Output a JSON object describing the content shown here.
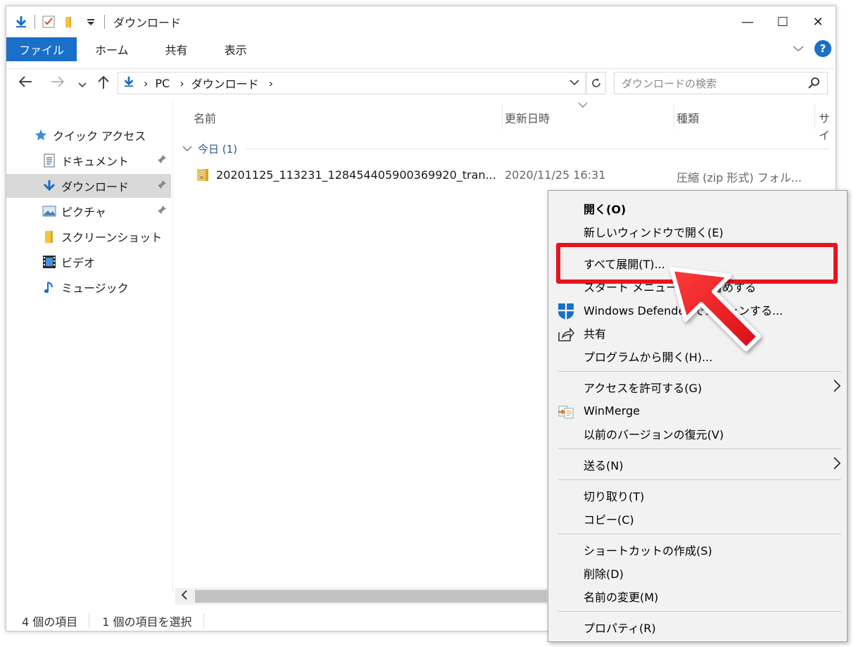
{
  "window": {
    "title": "ダウンロード",
    "controls": {
      "minimize": "—",
      "maximize": "☐",
      "close": "✕"
    }
  },
  "ribbon": {
    "tabs": [
      {
        "label": "ファイル"
      },
      {
        "label": "ホーム"
      },
      {
        "label": "共有"
      },
      {
        "label": "表示"
      }
    ],
    "help": "?"
  },
  "address": {
    "segments": [
      "PC",
      "ダウンロード"
    ],
    "search_placeholder": "ダウンロードの検索"
  },
  "nav": {
    "quick_access": "クイック アクセス",
    "items": [
      {
        "label": "ドキュメント",
        "icon": "document-icon",
        "pinned": true
      },
      {
        "label": "ダウンロード",
        "icon": "download-icon",
        "pinned": true,
        "selected": true
      },
      {
        "label": "ピクチャ",
        "icon": "picture-icon",
        "pinned": true
      },
      {
        "label": "スクリーンショット",
        "icon": "folder-icon",
        "pinned": false
      },
      {
        "label": "ビデオ",
        "icon": "video-icon",
        "pinned": false
      },
      {
        "label": "ミュージック",
        "icon": "music-icon",
        "pinned": false
      }
    ]
  },
  "list": {
    "columns": [
      "名前",
      "更新日時",
      "種類",
      "サイ"
    ],
    "group": "今日 (1)",
    "rows": [
      {
        "name": "20201125_113231_128454405900369920_tran...",
        "date": "2020/11/25 16:31",
        "type": "圧縮 (zip 形式) フォル..."
      }
    ]
  },
  "status": {
    "count": "4 個の項目",
    "selected": "1 個の項目を選択"
  },
  "context_menu": {
    "items": [
      {
        "label": "開く(O)",
        "bold": true
      },
      {
        "label": "新しいウィンドウで開く(E)"
      },
      {
        "label": "すべて展開(T)..."
      },
      {
        "label": "スタート メニューにピン留めする"
      },
      {
        "label": "Windows Defender でスキャンする..."
      },
      {
        "label": "共有"
      },
      {
        "label": "プログラムから開く(H)..."
      },
      {
        "label": "アクセスを許可する(G)"
      },
      {
        "label": "WinMerge"
      },
      {
        "label": "以前のバージョンの復元(V)"
      },
      {
        "label": "送る(N)"
      },
      {
        "label": "切り取り(T)"
      },
      {
        "label": "コピー(C)"
      },
      {
        "label": "ショートカットの作成(S)"
      },
      {
        "label": "削除(D)"
      },
      {
        "label": "名前の変更(M)"
      },
      {
        "label": "プロパティ(R)"
      }
    ]
  },
  "colors": {
    "accent": "#1a6fc9",
    "highlight": "#e8141d"
  }
}
